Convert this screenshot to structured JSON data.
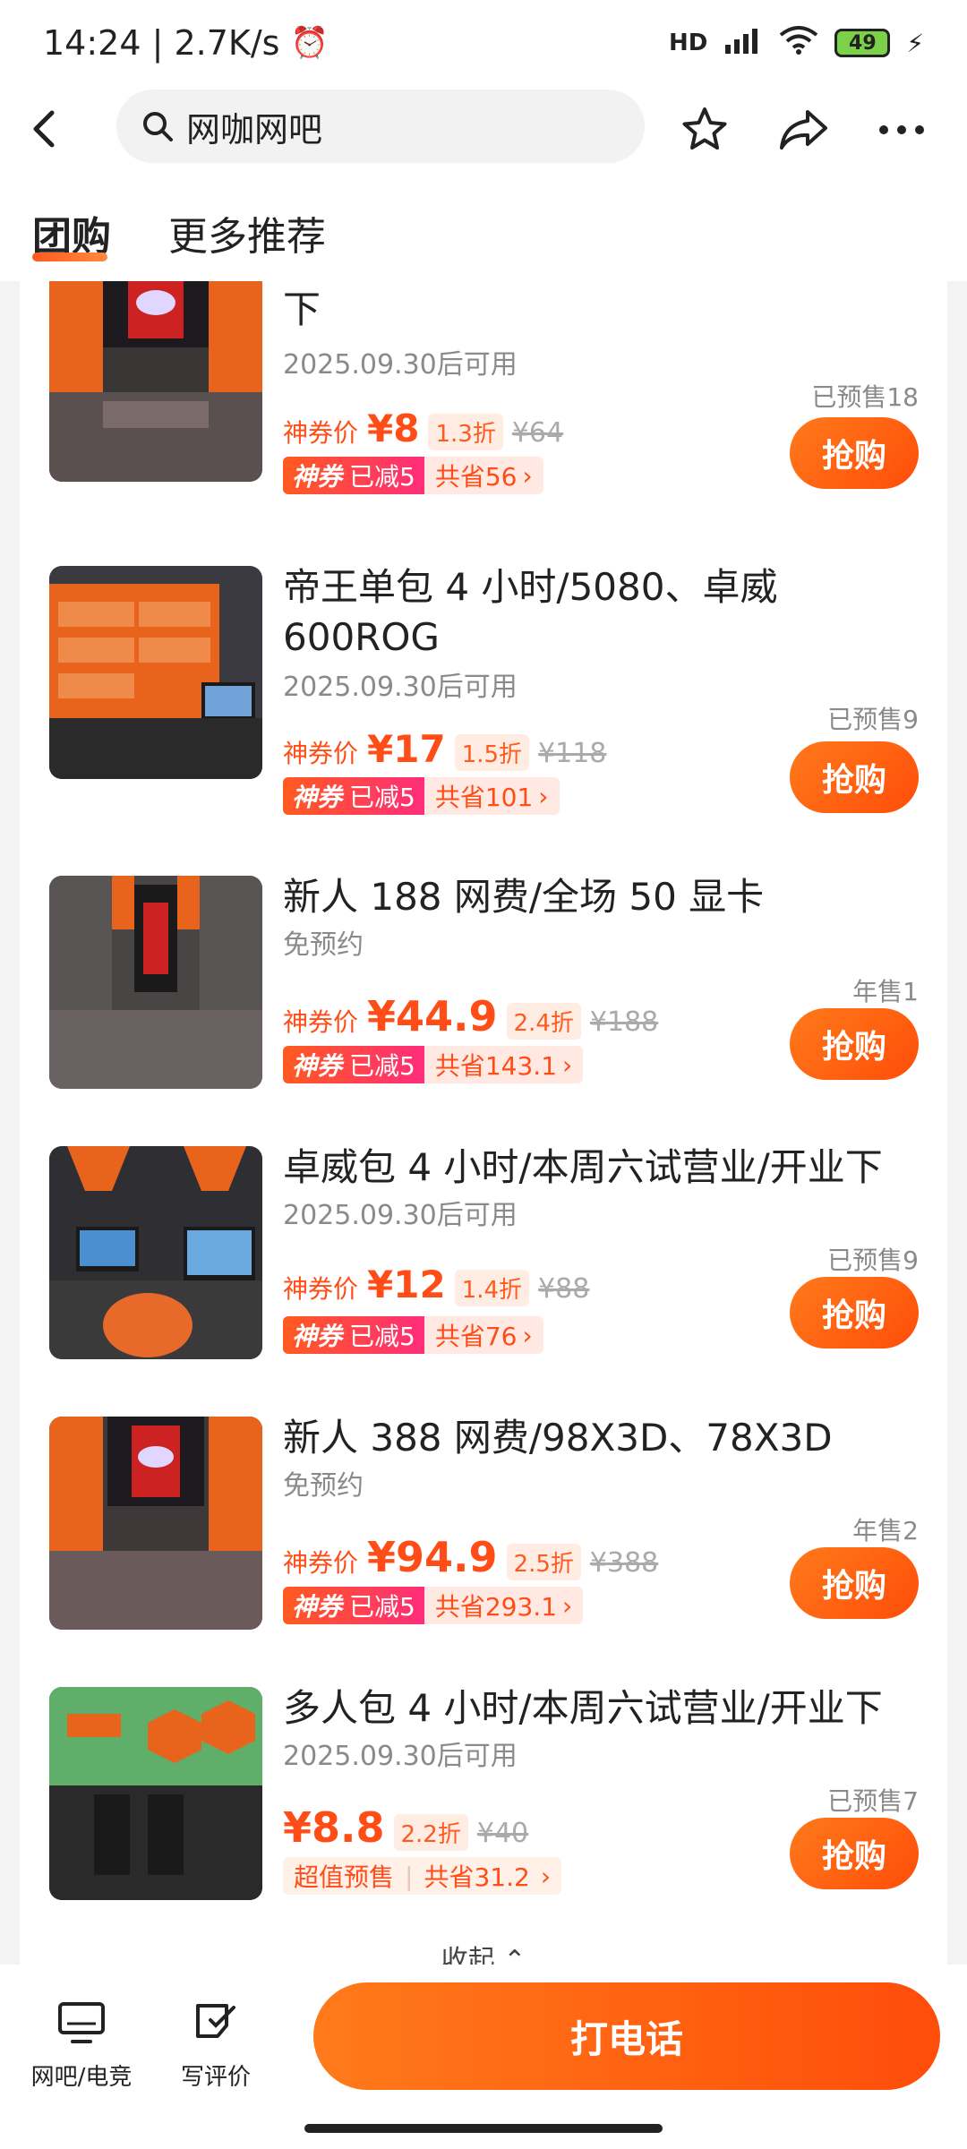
{
  "status_bar": {
    "time": "14:24 | 2.7K/s",
    "network": "HD",
    "battery": "49"
  },
  "header": {
    "search_text": "网咖网吧"
  },
  "tabs": [
    {
      "label": "团购"
    },
    {
      "label": "更多推荐"
    }
  ],
  "items": [
    {
      "title": "下",
      "sub": "2025.09.30后可用",
      "sold": "已预售18",
      "price_label": "神券价",
      "price": "¥8",
      "discount": "1.3折",
      "original": "¥64",
      "badge_a": "神券",
      "badge_b": "已减5",
      "savings": "共省56",
      "buy": "抢购"
    },
    {
      "title": "帝王单包 4 小时/5080、卓威600ROG",
      "sub": "2025.09.30后可用",
      "sold": "已预售9",
      "price_label": "神券价",
      "price": "¥17",
      "discount": "1.5折",
      "original": "¥118",
      "badge_a": "神券",
      "badge_b": "已减5",
      "savings": "共省101",
      "buy": "抢购"
    },
    {
      "title": "新人 188 网费/全场 50 显卡",
      "sub": "免预约",
      "sold": "年售1",
      "price_label": "神券价",
      "price": "¥44.9",
      "discount": "2.4折",
      "original": "¥188",
      "badge_a": "神券",
      "badge_b": "已减5",
      "savings": "共省143.1",
      "buy": "抢购"
    },
    {
      "title": "卓威包 4 小时/本周六试营业/开业下",
      "sub": "2025.09.30后可用",
      "sold": "已预售9",
      "price_label": "神券价",
      "price": "¥12",
      "discount": "1.4折",
      "original": "¥88",
      "badge_a": "神券",
      "badge_b": "已减5",
      "savings": "共省76",
      "buy": "抢购"
    },
    {
      "title": "新人 388 网费/98X3D、78X3D",
      "sub": "免预约",
      "sold": "年售2",
      "price_label": "神券价",
      "price": "¥94.9",
      "discount": "2.5折",
      "original": "¥388",
      "badge_a": "神券",
      "badge_b": "已减5",
      "savings": "共省293.1",
      "buy": "抢购"
    },
    {
      "title": "多人包 4 小时/本周六试营业/开业下",
      "sub": "2025.09.30后可用",
      "sold": "已预售7",
      "price_label": "",
      "price": "¥8.8",
      "discount": "2.2折",
      "original": "¥40",
      "badge_a": "超值预售",
      "badge_b": "",
      "savings": "共省31.2",
      "buy": "抢购"
    }
  ],
  "collapse_label": "收起",
  "bottom": {
    "nav1": "网吧/电竞",
    "nav2": "写评价",
    "call": "打电话"
  },
  "colors": {
    "accent": "#ff5a1f",
    "accent_dark": "#ff4d0a"
  }
}
